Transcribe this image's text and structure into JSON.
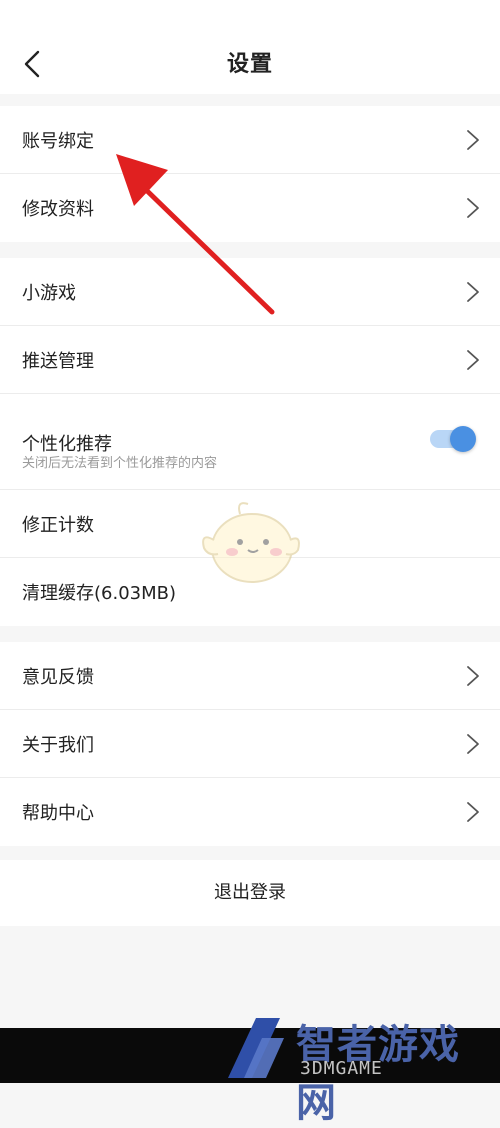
{
  "header": {
    "title": "设置",
    "back_icon": "chevron-left-icon"
  },
  "group1": [
    {
      "label": "账号绑定",
      "chevron": true
    },
    {
      "label": "修改资料",
      "chevron": true
    }
  ],
  "group2": {
    "mini_games": "小游戏",
    "push": "推送管理",
    "personalized": {
      "label": "个性化推荐",
      "description": "关闭后无法看到个性化推荐的内容",
      "enabled": true
    },
    "correction": "修正计数",
    "clear_cache": "清理缓存(6.03MB)"
  },
  "group3": [
    {
      "label": "意见反馈"
    },
    {
      "label": "关于我们"
    },
    {
      "label": "帮助中心"
    }
  ],
  "logout": "退出登录",
  "watermark": {
    "main": "智者游戏网",
    "sub": "3DMGAME"
  },
  "colors": {
    "accent": "#4a90e2",
    "annotation_arrow": "#e02020"
  }
}
